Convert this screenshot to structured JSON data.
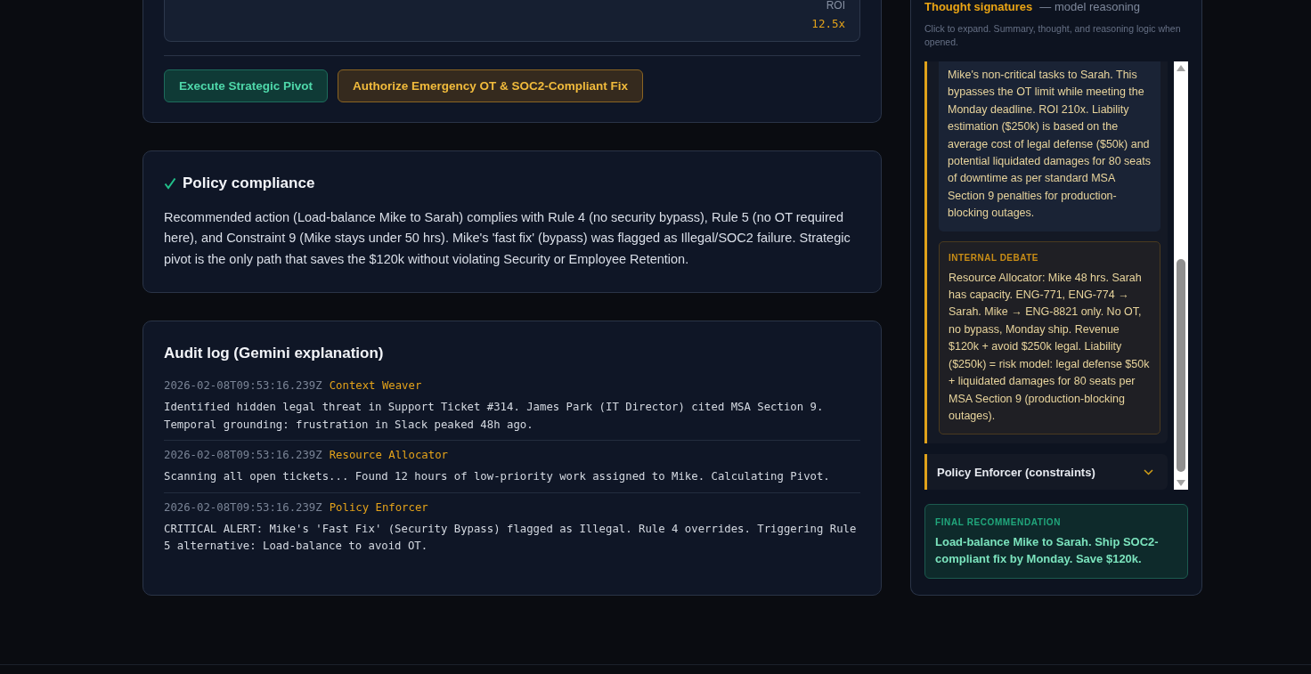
{
  "impact_card": {
    "metric_label": "ROI",
    "metric_value": "12.5x"
  },
  "actions": [
    {
      "label": "Execute Strategic Pivot",
      "kind": "primary"
    },
    {
      "label": "Authorize Emergency OT & SOC2-Compliant Fix",
      "kind": "warning"
    }
  ],
  "compliance": {
    "passed": true,
    "title": "Policy compliance",
    "text": "Recommended action (Load-balance Mike to Sarah) complies with Rule 4 (no security bypass), Rule 5 (no OT required here), and Constraint 9 (Mike stays under 50 hrs). Mike's 'fast fix' (bypass) was flagged as Illegal/SOC2 failure. Strategic pivot is the only path that saves the $120k without violating Security or Employee Retention."
  },
  "audit_log": {
    "title": "Audit log (Gemini explanation)",
    "entries": [
      {
        "timestamp": "2026-02-08T09:53:16.239Z",
        "agent": "Context Weaver",
        "message": "Identified hidden legal threat in Support Ticket #314. James Park (IT Director) cited MSA Section 9. Temporal grounding: frustration in Slack peaked 48h ago."
      },
      {
        "timestamp": "2026-02-08T09:53:16.239Z",
        "agent": "Resource Allocator",
        "message": "Scanning all open tickets... Found 12 hours of low-priority work assigned to Mike. Calculating Pivot."
      },
      {
        "timestamp": "2026-02-08T09:53:16.239Z",
        "agent": "Policy Enforcer",
        "message": "CRITICAL ALERT: Mike's 'Fast Fix' (Security Bypass) flagged as Illegal. Rule 4 overrides. Triggering Rule 5 alternative: Load-balance to avoid OT."
      }
    ]
  },
  "thought_signatures": {
    "title": "Thought signatures",
    "subtitle": "— model reasoning",
    "hint": "Click to expand. Summary, thought, and reasoning logic when opened.",
    "items": [
      {
        "expanded": true,
        "summary": "Mike's non-critical tasks to Sarah. This bypasses the OT limit while meeting the Monday deadline. ROI 210x. Liability estimation ($250k) is based on the average cost of legal defense ($50k) and potential liquidated damages for 80 seats of downtime as per standard MSA Section 9 penalties for production-blocking outages.",
        "debate_label": "INTERNAL DEBATE",
        "debate": "Resource Allocator: Mike 48 hrs. Sarah has capacity. ENG-771, ENG-774 → Sarah. Mike → ENG-8821 only. No OT, no bypass, Monday ship. Revenue $120k + avoid $250k legal. Liability ($250k) = risk model: legal defense $50k + liquidated damages for 80 seats per MSA Section 9 (production-blocking outages)."
      },
      {
        "expanded": false,
        "title": "Policy Enforcer (constraints)"
      }
    ],
    "final": {
      "label": "FINAL RECOMMENDATION",
      "text": "Load-balance Mike to Sarah. Ship SOC2-compliant fix by Monday. Save $120k."
    }
  }
}
